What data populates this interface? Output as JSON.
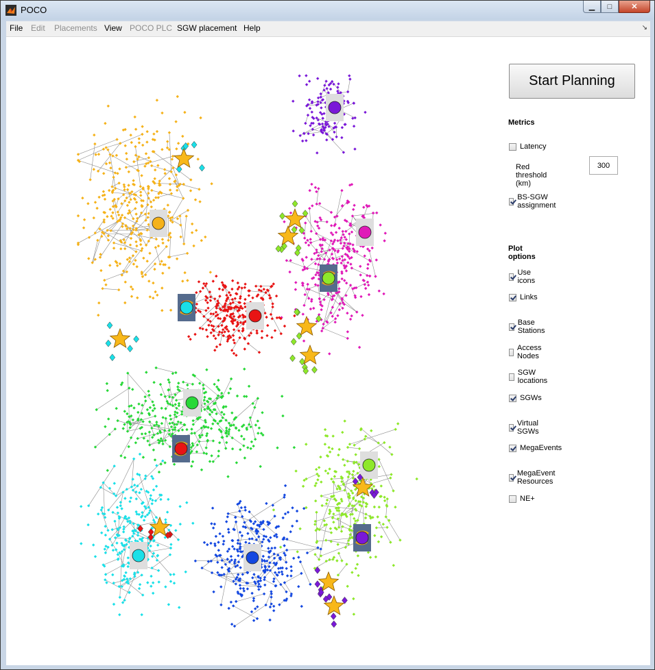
{
  "window": {
    "title": "POCO",
    "min": "▁",
    "max": "□",
    "close": "✕"
  },
  "menu": {
    "file": "File",
    "edit": "Edit",
    "placements": "Placements",
    "view": "View",
    "poco_plc": "POCO PLC",
    "sgw_placement": "SGW placement",
    "help": "Help",
    "dock_arrow": "↘"
  },
  "panel": {
    "start_button": "Start Planning",
    "metrics_heading": "Metrics",
    "latency": {
      "label": "Latency",
      "checked": false
    },
    "red_threshold_label": "Red threshold (km)",
    "red_threshold_value": "300",
    "bs_sgw": {
      "label": "BS-SGW assignment",
      "checked": true
    },
    "plot_heading": "Plot options",
    "options": [
      {
        "label": "Use icons",
        "checked": true
      },
      {
        "label": "Links",
        "checked": true
      },
      {
        "label": "Base Stations",
        "checked": true
      },
      {
        "label": "Access Nodes",
        "checked": false
      },
      {
        "label": "SGW locations",
        "checked": false
      },
      {
        "label": "SGWs",
        "checked": true
      },
      {
        "label": "Virtual SGWs",
        "checked": true
      },
      {
        "label": "MegaEvents",
        "checked": true
      },
      {
        "label": "MegaEvent Resources",
        "checked": true
      },
      {
        "label": "NE+",
        "checked": false
      }
    ]
  },
  "colors": {
    "orange": "#f5b21a",
    "violet": "#7a18d8",
    "magenta": "#e01ab8",
    "red": "#e81414",
    "green": "#28d838",
    "lime": "#8ee82a",
    "cyan": "#1ae0e8",
    "blue": "#1448e0",
    "star": "#f8b81a",
    "sgw_bg": "#dedede",
    "vsgw_bg": "#556b8d"
  },
  "map": {
    "clusters": [
      {
        "color": "orange",
        "count": 390
      },
      {
        "color": "violet",
        "count": 150
      },
      {
        "color": "magenta",
        "count": 330
      },
      {
        "color": "red",
        "count": 280
      },
      {
        "color": "green",
        "count": 380
      },
      {
        "color": "lime",
        "count": 300
      },
      {
        "color": "cyan",
        "count": 280
      },
      {
        "color": "blue",
        "count": 330
      }
    ],
    "sgws": [
      {
        "color": "violet",
        "type": "physical"
      },
      {
        "color": "orange",
        "type": "physical"
      },
      {
        "color": "magenta",
        "type": "physical"
      },
      {
        "color": "lime",
        "type": "virtual"
      },
      {
        "color": "cyan",
        "type": "virtual"
      },
      {
        "color": "red",
        "type": "physical"
      },
      {
        "color": "green",
        "type": "physical"
      },
      {
        "color": "red",
        "type": "virtual"
      },
      {
        "color": "lime",
        "type": "physical"
      },
      {
        "color": "violet",
        "type": "virtual"
      },
      {
        "color": "cyan",
        "type": "physical"
      },
      {
        "color": "blue",
        "type": "physical"
      }
    ],
    "megaevents": 11
  }
}
